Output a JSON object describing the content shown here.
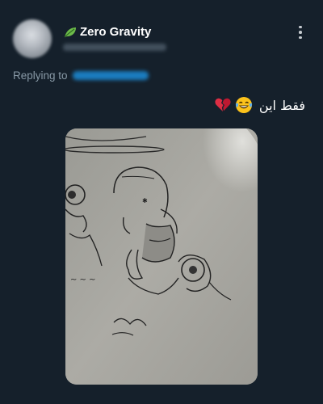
{
  "author": {
    "display_name": "Zero Gravity",
    "badge_icon": "leaf-icon"
  },
  "reply": {
    "prefix": "Replying to"
  },
  "post": {
    "text": "فقط این",
    "emojis": [
      "face-with-tears-of-joy-icon",
      "broken-heart-icon"
    ]
  },
  "menu": {
    "icon": "more-vertical-icon"
  },
  "colors": {
    "background": "#15202b",
    "secondary_text": "#8899a6",
    "link": "#1d9bf0"
  }
}
